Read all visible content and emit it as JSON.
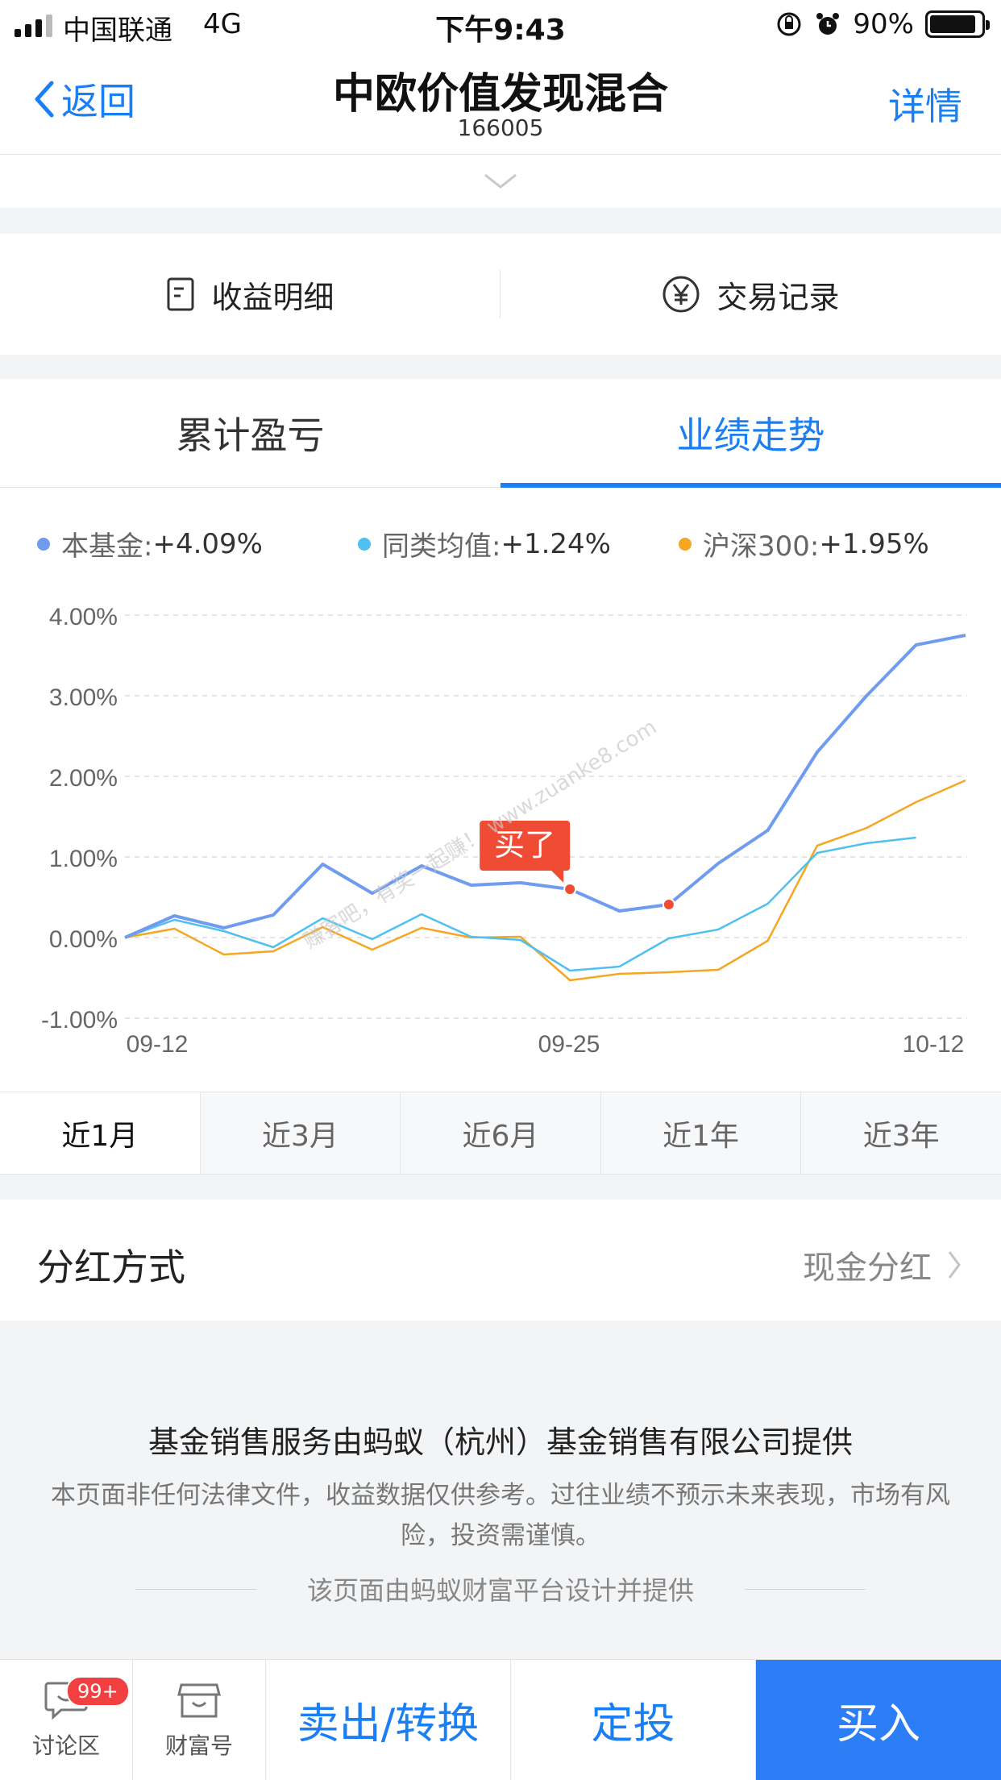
{
  "status_bar": {
    "carrier": "中国联通",
    "network": "4G",
    "time": "下午9:43",
    "battery": "90%",
    "battery_level": 0.9
  },
  "nav": {
    "back_label": "返回",
    "title": "中欧价值发现混合",
    "code": "166005",
    "detail_label": "详情"
  },
  "actions": {
    "income_detail": "收益明细",
    "trade_record": "交易记录"
  },
  "tabs": {
    "cumulative": "累计盈亏",
    "performance": "业绩走势",
    "active": "业绩走势"
  },
  "legend": [
    {
      "name": "本基金:",
      "value": "+4.09%",
      "color": "#6f9cf0"
    },
    {
      "name": "同类均值:",
      "value": "+1.24%",
      "color": "#4fc0f0"
    },
    {
      "name": "沪深300:",
      "value": "+1.95%",
      "color": "#f5a623"
    }
  ],
  "chart_data": {
    "type": "line",
    "y_ticks": [
      "4.00%",
      "3.00%",
      "2.00%",
      "1.00%",
      "0.00%",
      "-1.00%"
    ],
    "ylim": [
      -1.0,
      4.0
    ],
    "x_ticks": [
      "09-12",
      "09-25",
      "10-12"
    ],
    "grid": true,
    "series": [
      {
        "name": "本基金",
        "color": "#6f9cf0",
        "values": [
          0.0,
          0.27,
          0.12,
          0.28,
          0.91,
          0.55,
          0.89,
          0.65,
          0.68,
          0.6,
          0.33,
          0.41,
          0.92,
          1.33,
          2.3,
          3.0,
          3.63,
          3.75
        ]
      },
      {
        "name": "同类均值",
        "color": "#4fc0f0",
        "values": [
          0.0,
          0.22,
          0.08,
          -0.12,
          0.24,
          -0.02,
          0.29,
          0.01,
          -0.03,
          -0.41,
          -0.36,
          -0.01,
          0.1,
          0.42,
          1.05,
          1.17,
          1.24,
          null
        ]
      },
      {
        "name": "沪深300",
        "color": "#f5a623",
        "values": [
          0.0,
          0.11,
          -0.21,
          -0.17,
          0.13,
          -0.15,
          0.12,
          0.0,
          0.01,
          -0.53,
          -0.45,
          -0.43,
          -0.4,
          -0.04,
          1.14,
          1.36,
          1.68,
          1.95
        ]
      }
    ],
    "markers": [
      {
        "index": 9,
        "series": 0
      },
      {
        "index": 11,
        "series": 0
      }
    ],
    "annotation": "买了"
  },
  "periods": [
    "近1月",
    "近3月",
    "近6月",
    "近1年",
    "近3年"
  ],
  "active_period": "近1月",
  "dividend": {
    "label": "分红方式",
    "value": "现金分红"
  },
  "footer": {
    "provider": "基金销售服务由蚂蚁（杭州）基金销售有限公司提供",
    "disclaimer": "本页面非任何法律文件，收益数据仅供参考。过往业绩不预示未来表现，市场有风险，投资需谨慎。",
    "designed_by": "该页面由蚂蚁财富平台设计并提供"
  },
  "bottom_bar": {
    "discuss_label": "讨论区",
    "discuss_badge": "99+",
    "wealth_label": "财富号",
    "sell_label": "卖出/转换",
    "fixed_label": "定投",
    "buy_label": "买入"
  },
  "watermark": "赚客吧，有奖一起赚！ www.zuanke8.com"
}
